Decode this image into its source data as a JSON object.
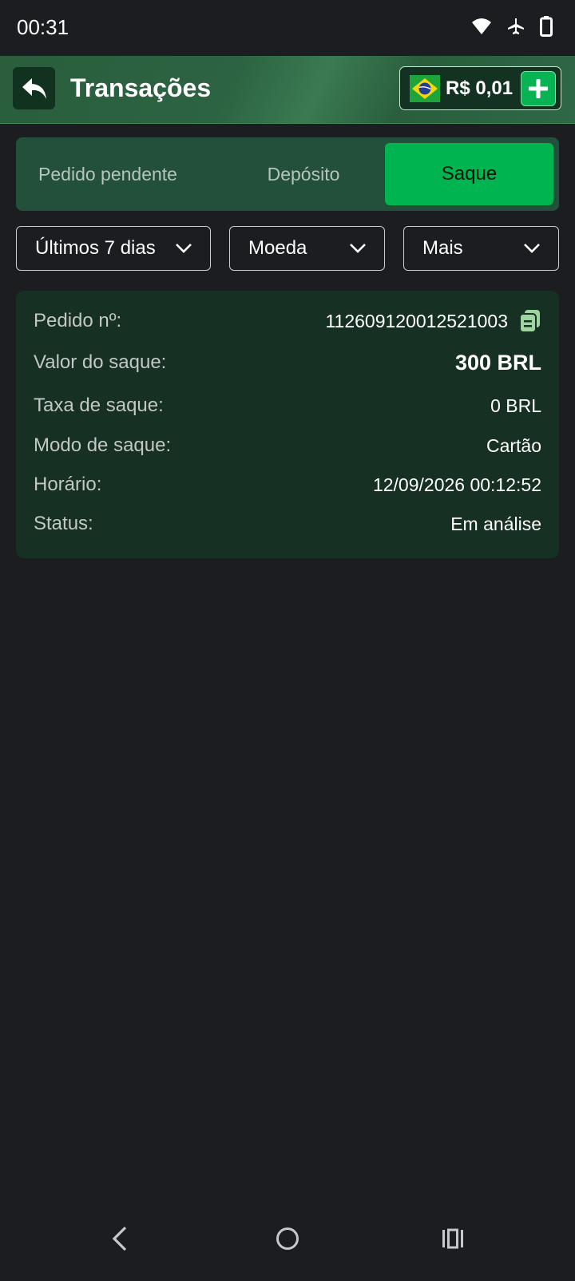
{
  "status_bar": {
    "time": "00:31"
  },
  "header": {
    "title": "Transações",
    "balance": "R$ 0,01"
  },
  "tabs": [
    {
      "label": "Pedido pendente",
      "active": false
    },
    {
      "label": "Depósito",
      "active": false
    },
    {
      "label": "Saque",
      "active": true
    }
  ],
  "filters": [
    {
      "label": "Últimos 7 dias"
    },
    {
      "label": "Moeda"
    },
    {
      "label": "Mais"
    }
  ],
  "transaction": {
    "rows": [
      {
        "label": "Pedido nº:",
        "value": "112609120012521003"
      },
      {
        "label": "Valor do saque:",
        "value": "300 BRL"
      },
      {
        "label": "Taxa de saque:",
        "value": "0 BRL"
      },
      {
        "label": "Modo de saque:",
        "value": "Cartão"
      },
      {
        "label": "Horário:",
        "value": "12/09/2026 00:12:52"
      },
      {
        "label": "Status:",
        "value": "Em análise"
      }
    ]
  },
  "colors": {
    "accent": "#00b44f",
    "header": "#2c6342",
    "card": "#163023",
    "background": "#1c1d21"
  }
}
